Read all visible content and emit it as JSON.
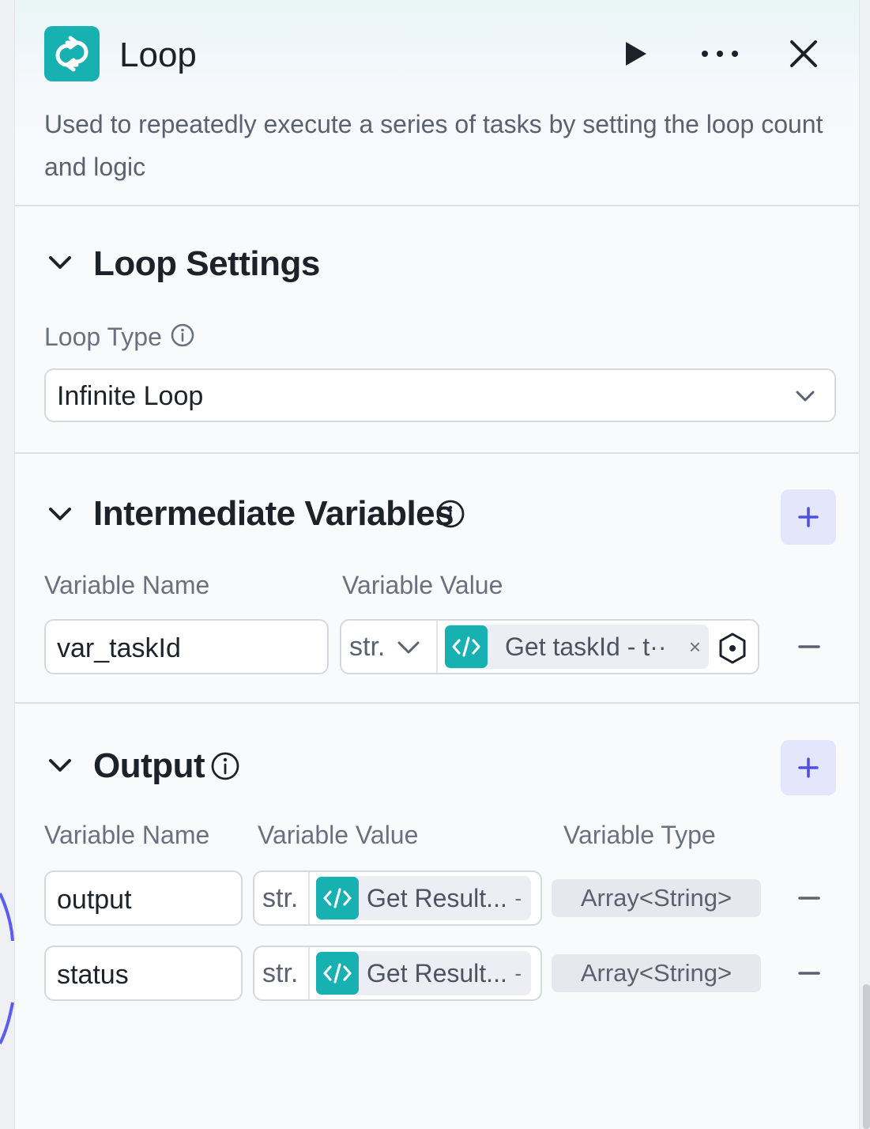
{
  "header": {
    "title": "Loop",
    "description": "Used to repeatedly execute a series of tasks by setting the loop count and logic",
    "icon": "loop-arrows-icon",
    "accent_color": "#16b1b0"
  },
  "loop_settings": {
    "title": "Loop Settings",
    "loop_type_label": "Loop Type",
    "loop_type_value": "Infinite Loop"
  },
  "intermediate": {
    "title": "Intermediate Variables",
    "col_name": "Variable Name",
    "col_value": "Variable Value",
    "rows": [
      {
        "name": "var_taskId",
        "type": "str.",
        "ref": "Get taskId - t··",
        "clear": "×"
      }
    ]
  },
  "output": {
    "title": "Output",
    "col_name": "Variable Name",
    "col_value": "Variable Value",
    "col_type": "Variable Type",
    "rows": [
      {
        "name": "output",
        "type": "str.",
        "ref": "Get Result...",
        "ref_extra": "-",
        "var_type": "Array<String>"
      },
      {
        "name": "status",
        "type": "str.",
        "ref": "Get Result...",
        "ref_extra": "-",
        "var_type": "Array<String>"
      }
    ]
  }
}
